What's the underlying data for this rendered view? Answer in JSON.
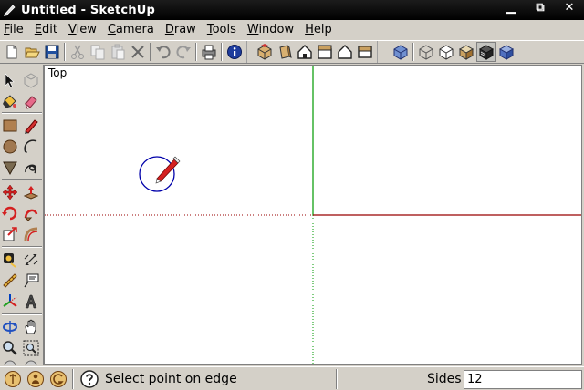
{
  "window": {
    "title": "Untitled - SketchUp",
    "controls": {
      "minimize": "▁",
      "restore": "⧉",
      "close": "✕"
    }
  },
  "menubar": {
    "items": [
      {
        "accel": "F",
        "rest": "ile"
      },
      {
        "accel": "E",
        "rest": "dit"
      },
      {
        "accel": "V",
        "rest": "iew"
      },
      {
        "accel": "C",
        "rest": "amera"
      },
      {
        "accel": "D",
        "rest": "raw"
      },
      {
        "accel": "T",
        "rest": "ools"
      },
      {
        "accel": "W",
        "rest": "indow"
      },
      {
        "accel": "H",
        "rest": "elp"
      }
    ]
  },
  "toolbar": {
    "icons": [
      "new-icon",
      "open-icon",
      "save-icon",
      "cut-icon",
      "copy-icon",
      "paste-icon",
      "erase-icon",
      "undo-icon",
      "redo-icon",
      "print-icon",
      "model-info-icon",
      "view-iso-icon",
      "view-top-icon",
      "view-front-icon",
      "view-right-icon",
      "view-back-icon",
      "view-left-icon",
      "xray-icon",
      "wireframe-icon",
      "hidden-line-icon",
      "shaded-icon",
      "shaded-textures-icon",
      "monochrome-icon"
    ]
  },
  "viewport": {
    "view_name": "Top",
    "colors": {
      "green_axis": "#009900",
      "red_axis": "#990000",
      "cursor_circle": "#0000aa"
    }
  },
  "statusbar": {
    "message": "Select point on edge",
    "vcb_label": "Sides",
    "vcb_value": "12"
  }
}
